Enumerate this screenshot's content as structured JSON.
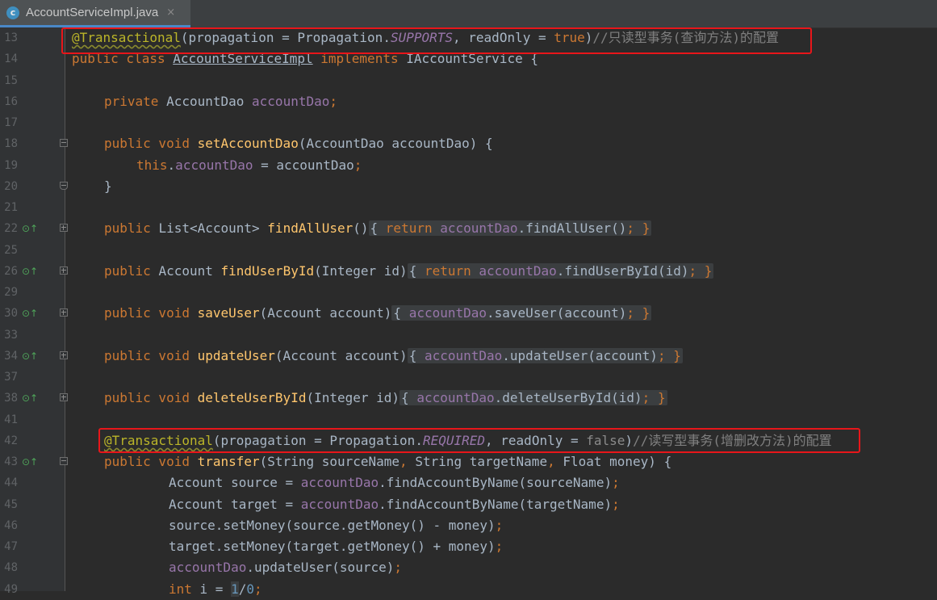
{
  "tab": {
    "icon_letter": "c",
    "file_name": "AccountServiceImpl.java",
    "close_glyph": "×"
  },
  "lines": [
    {
      "n": "13",
      "a": "@Transactional",
      "b": "(propagation = Propagation.",
      "c": "SUPPORTS",
      "d": ", readOnly = ",
      "e": "true",
      "f": ")",
      "g": "//只读型事务(查询方法)的配置"
    },
    {
      "n": "14",
      "a": "public class ",
      "b": "AccountServiceImpl",
      "c": " implements ",
      "d": "IAccountService {"
    },
    {
      "n": "15"
    },
    {
      "n": "16",
      "a": "private ",
      "b": "AccountDao ",
      "c": "accountDao",
      "d": ";"
    },
    {
      "n": "17"
    },
    {
      "n": "18",
      "a": "public void ",
      "b": "setAccountDao",
      "c": "(AccountDao accountDao) {"
    },
    {
      "n": "19",
      "a": "this",
      "b": ".",
      "c": "accountDao",
      "d": " = accountDao",
      "e": ";"
    },
    {
      "n": "20",
      "a": "}"
    },
    {
      "n": "21"
    },
    {
      "n": "22",
      "a": "public ",
      "b": "List<Account> ",
      "c": "findAllUser",
      "d": "()",
      "e": "{ ",
      "f": "return ",
      "g": "accountDao",
      "h": ".findAllUser()",
      "i": "; }"
    },
    {
      "n": "25"
    },
    {
      "n": "26",
      "a": "public ",
      "b": "Account ",
      "c": "findUserById",
      "d": "(Integer id)",
      "e": "{ ",
      "f": "return ",
      "g": "accountDao",
      "h": ".findUserById(id)",
      "i": "; }"
    },
    {
      "n": "29"
    },
    {
      "n": "30",
      "a": "public void ",
      "b": "saveUser",
      "c": "(Account account)",
      "e": "{ ",
      "g": "accountDao",
      "h": ".saveUser(account)",
      "i": "; }"
    },
    {
      "n": "33"
    },
    {
      "n": "34",
      "a": "public void ",
      "b": "updateUser",
      "c": "(Account account)",
      "e": "{ ",
      "g": "accountDao",
      "h": ".updateUser(account)",
      "i": "; }"
    },
    {
      "n": "37"
    },
    {
      "n": "38",
      "a": "public void ",
      "b": "deleteUserById",
      "c": "(Integer id)",
      "e": "{ ",
      "g": "accountDao",
      "h": ".deleteUserById(id)",
      "i": "; }"
    },
    {
      "n": "41"
    },
    {
      "n": "42",
      "a": "@Transactional",
      "b": "(propagation = Propagation.",
      "c": "REQUIRED",
      "d": ", readOnly = ",
      "e": "false",
      "f": ")",
      "g": "//读写型事务(增删改方法)的配置"
    },
    {
      "n": "43",
      "a": "public void ",
      "b": "transfer",
      "c": "(String sourceName",
      "d": ", ",
      "e": "String targetName",
      "f": ", ",
      "g": "Float money) {"
    },
    {
      "n": "44",
      "a": "Account source = ",
      "b": "accountDao",
      "c": ".findAccountByName(sourceName)",
      "d": ";"
    },
    {
      "n": "45",
      "a": "Account target = ",
      "b": "accountDao",
      "c": ".findAccountByName(targetName)",
      "d": ";"
    },
    {
      "n": "46",
      "a": "source.setMoney(source.getMoney() - money)",
      "b": ";"
    },
    {
      "n": "47",
      "a": "target.setMoney(target.getMoney() + money)",
      "b": ";"
    },
    {
      "n": "48",
      "a": "accountDao",
      "b": ".updateUser(source)",
      "c": ";"
    },
    {
      "n": "49",
      "a": "int ",
      "b": "i = ",
      "c": "1",
      "d": "/",
      "e": "0",
      "f": ";"
    }
  ],
  "colors": {
    "background": "#2b2b2b",
    "highlight_box": "#e8161a",
    "annotation": "#bbb529",
    "keyword": "#cc7832",
    "field": "#9876aa",
    "method": "#ffc66d"
  }
}
